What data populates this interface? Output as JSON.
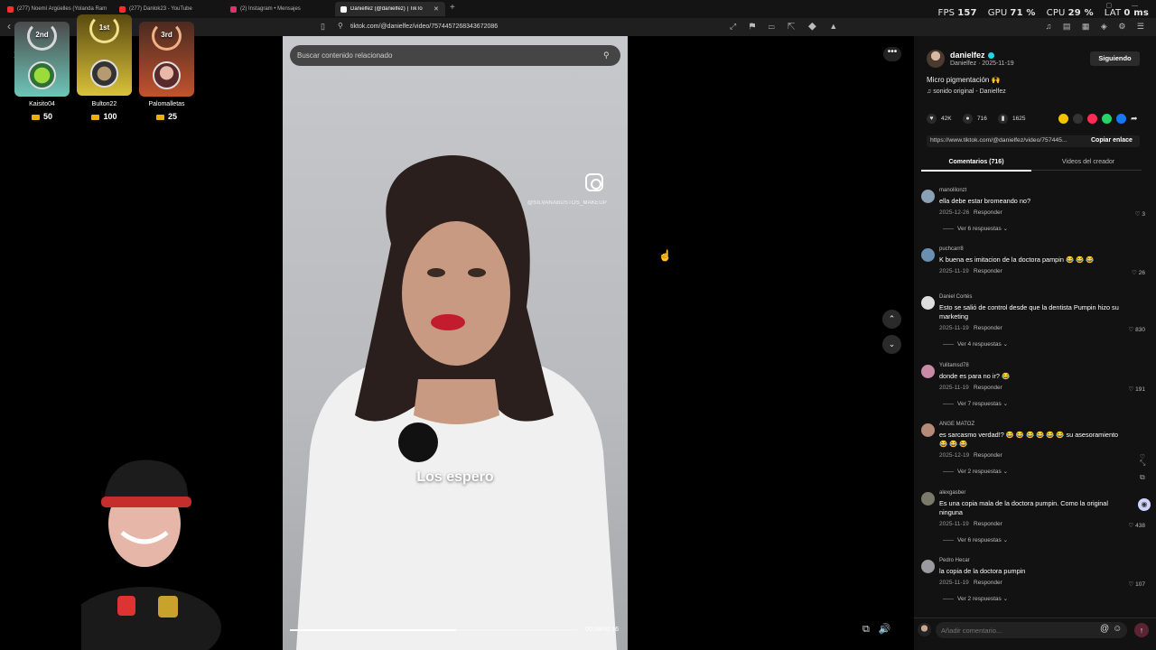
{
  "browser": {
    "tabs": [
      {
        "label": "(277) Noemí Argüelles (Yolanda Ram",
        "color": "#ff2d2d"
      },
      {
        "label": "(277) Danlok23 - YouTube",
        "color": "#ff2d2d"
      },
      {
        "label": "(2) Instagram • Mensajes",
        "color": "#e1306c"
      },
      {
        "label": "Danielfez (@danielfez) | TikTok",
        "color": "#ffffff"
      }
    ],
    "url": "tiktok.com/@danielfez/video/7574457268343672086",
    "stats": {
      "fps_label": "FPS",
      "fps": "157",
      "gpu_label": "GPU",
      "gpu": "71 %",
      "cpu_label": "CPU",
      "cpu": "29 %",
      "lat_label": "LAT",
      "lat": "0 ms"
    }
  },
  "leaderboard": [
    {
      "place": "2nd",
      "name": "Kaisito04",
      "score": "50",
      "bg": "#6ec6b8",
      "laurel": "#d8d8d8"
    },
    {
      "place": "1st",
      "name": "Bulton22",
      "score": "100",
      "bg": "#d9c23a",
      "laurel": "#f2e08c"
    },
    {
      "place": "3rd",
      "name": "Palomalletas",
      "score": "25",
      "bg": "#c2532e",
      "laurel": "#f1b085"
    }
  ],
  "video": {
    "search_placeholder": "Buscar contenido relacionado",
    "watermark": "@SILVANABUSTOS_MAKEUP",
    "caption": "Los espero",
    "time": "00:09/00:16",
    "progress": 0.58
  },
  "panel": {
    "author": "danielfez",
    "author_meta": "Danielfez · 2025-11-19",
    "follow_label": "Siguiendo",
    "description": "Micro pigmentación 🙌",
    "sound": "sonido original - Danielfez",
    "likes": "42K",
    "comments_count": "716",
    "saves": "1625",
    "link": "https://www.tiktok.com/@danielfez/video/757445...",
    "copy_label": "Copiar enlace",
    "tab_comments": "Comentarios (716)",
    "tab_videos": "Videos del creador",
    "input_placeholder": "Añadir comentario..."
  },
  "comments": [
    {
      "user": "manolilonzt",
      "text": "ella debe estar bromeando no?",
      "date": "2025-12-26",
      "reply": "Responder",
      "likes": "3",
      "more": "Ver 6 respuestas",
      "color": "#8aa0b5"
    },
    {
      "user": "puchcarr8",
      "text": "K buena es imitacion de la doctora pampin 😂 😂 😂",
      "date": "2025-11-19",
      "reply": "Responder",
      "likes": "26",
      "more": "",
      "color": "#6b8fb0"
    },
    {
      "user": "Daniel Cortés",
      "text": "Esto se salió de control desde que la dentista Pumpin hizo su marketing",
      "date": "2025-11-19",
      "reply": "Responder",
      "likes": "830",
      "more": "Ver 4 respuestas",
      "color": "#dddddd"
    },
    {
      "user": "Yulitamsd78",
      "text": "donde es para no ir? 😂",
      "date": "2025-11-19",
      "reply": "Responder",
      "likes": "191",
      "more": "Ver 7 respuestas",
      "color": "#c98aa8"
    },
    {
      "user": "ANGE MATOZ",
      "text": "es sarcasmo verdad!? 😂 😂 😂 😂 😂 😂 su asesoramiento 😂 😂 😂",
      "date": "2025-12-19",
      "reply": "Responder",
      "likes": "",
      "more": "Ver 2 respuestas",
      "color": "#b58a78"
    },
    {
      "user": "alexgasber",
      "text": "Es una copia mala de la doctora pumpin. Como la original ninguna",
      "date": "2025-11-19",
      "reply": "Responder",
      "likes": "438",
      "more": "Ver 6 respuestas",
      "color": "#7a7a6a"
    },
    {
      "user": "Pedro Hecar",
      "text": "la copia de la doctora pumpin",
      "date": "2025-11-19",
      "reply": "Responder",
      "likes": "107",
      "more": "Ver 2 respuestas",
      "color": "#9a9aa0"
    }
  ]
}
